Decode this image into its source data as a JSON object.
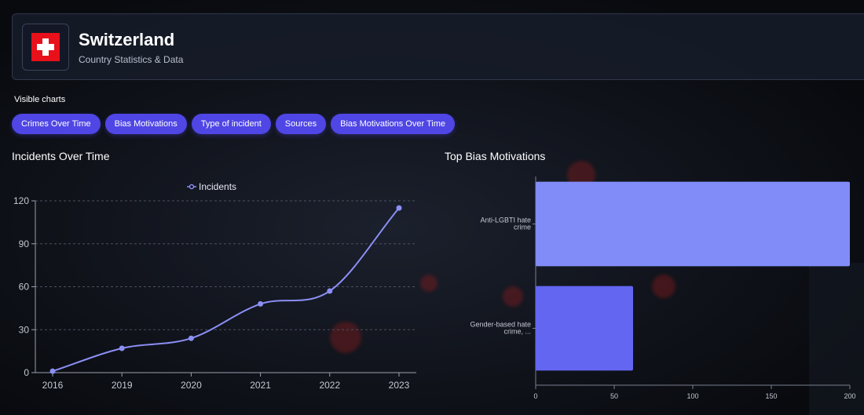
{
  "header": {
    "title": "Switzerland",
    "subtitle": "Country Statistics & Data",
    "flag_icon": "swiss-flag-icon",
    "flag_color": "#e8101a"
  },
  "visible_charts": {
    "label": "Visible charts",
    "chips": [
      {
        "label": "Crimes Over Time"
      },
      {
        "label": "Bias Motivations"
      },
      {
        "label": "Type of incident"
      },
      {
        "label": "Sources"
      },
      {
        "label": "Bias Motivations Over Time"
      }
    ],
    "chip_color": "#4f46e5"
  },
  "panels": {
    "incidents_title": "Incidents Over Time",
    "bias_title": "Top Bias Motivations"
  },
  "chart_data": [
    {
      "type": "line",
      "title": "Incidents Over Time",
      "legend": "Incidents",
      "legend_position": "top",
      "x": [
        "2016",
        "2019",
        "2020",
        "2021",
        "2022",
        "2023"
      ],
      "series": [
        {
          "name": "Incidents",
          "values": [
            1,
            17,
            24,
            48,
            57,
            115
          ],
          "color": "#8b8ff5"
        }
      ],
      "ylim": [
        0,
        120
      ],
      "yticks": [
        0,
        30,
        60,
        90,
        120
      ],
      "grid": true
    },
    {
      "type": "bar",
      "orientation": "horizontal",
      "title": "Top Bias Motivations",
      "categories": [
        [
          "Anti-LGBTI hate",
          "crime"
        ],
        [
          "Gender-based hate",
          "crime, ..."
        ]
      ],
      "values": [
        200,
        62
      ],
      "colors": [
        "#818cf8",
        "#6366f1"
      ],
      "xlim": [
        0,
        200
      ],
      "xticks": [
        0,
        50,
        100,
        150,
        200
      ]
    }
  ]
}
